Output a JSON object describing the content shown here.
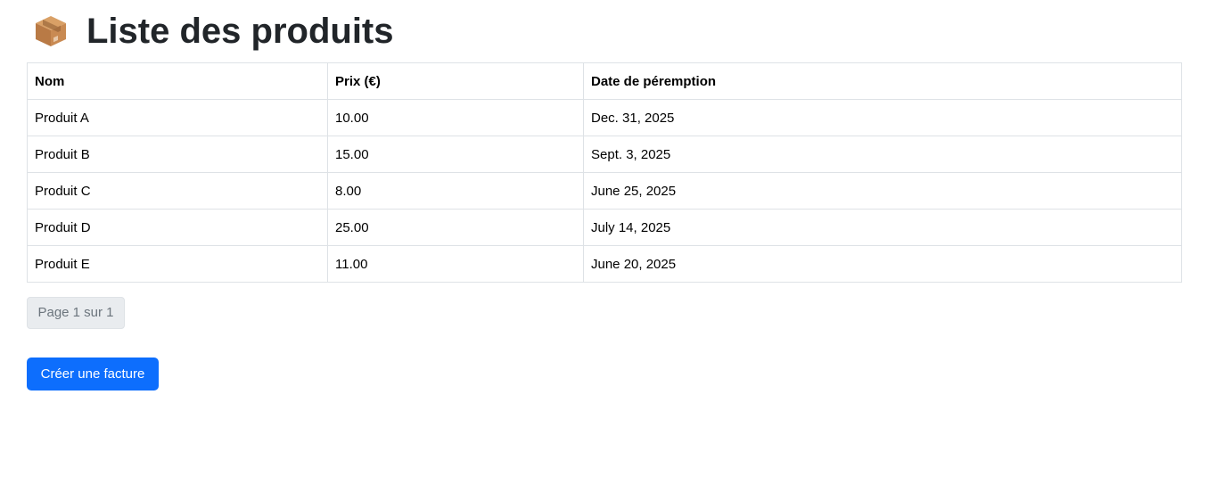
{
  "page": {
    "title": "Liste des produits",
    "icon": "package-box-icon"
  },
  "table": {
    "headers": [
      "Nom",
      "Prix (€)",
      "Date de péremption"
    ],
    "rows": [
      {
        "name": "Produit A",
        "price": "10.00",
        "expiry": "Dec. 31, 2025"
      },
      {
        "name": "Produit B",
        "price": "15.00",
        "expiry": "Sept. 3, 2025"
      },
      {
        "name": "Produit C",
        "price": "8.00",
        "expiry": "June 25, 2025"
      },
      {
        "name": "Produit D",
        "price": "25.00",
        "expiry": "July 14, 2025"
      },
      {
        "name": "Produit E",
        "price": "11.00",
        "expiry": "June 20, 2025"
      }
    ]
  },
  "pagination": {
    "label": "Page 1 sur 1"
  },
  "actions": {
    "create_invoice_label": "Créer une facture"
  },
  "colors": {
    "primary": "#0d6efd",
    "border": "#dee2e6",
    "pagination_bg": "#e9ecef",
    "pagination_text": "#6c757d"
  }
}
